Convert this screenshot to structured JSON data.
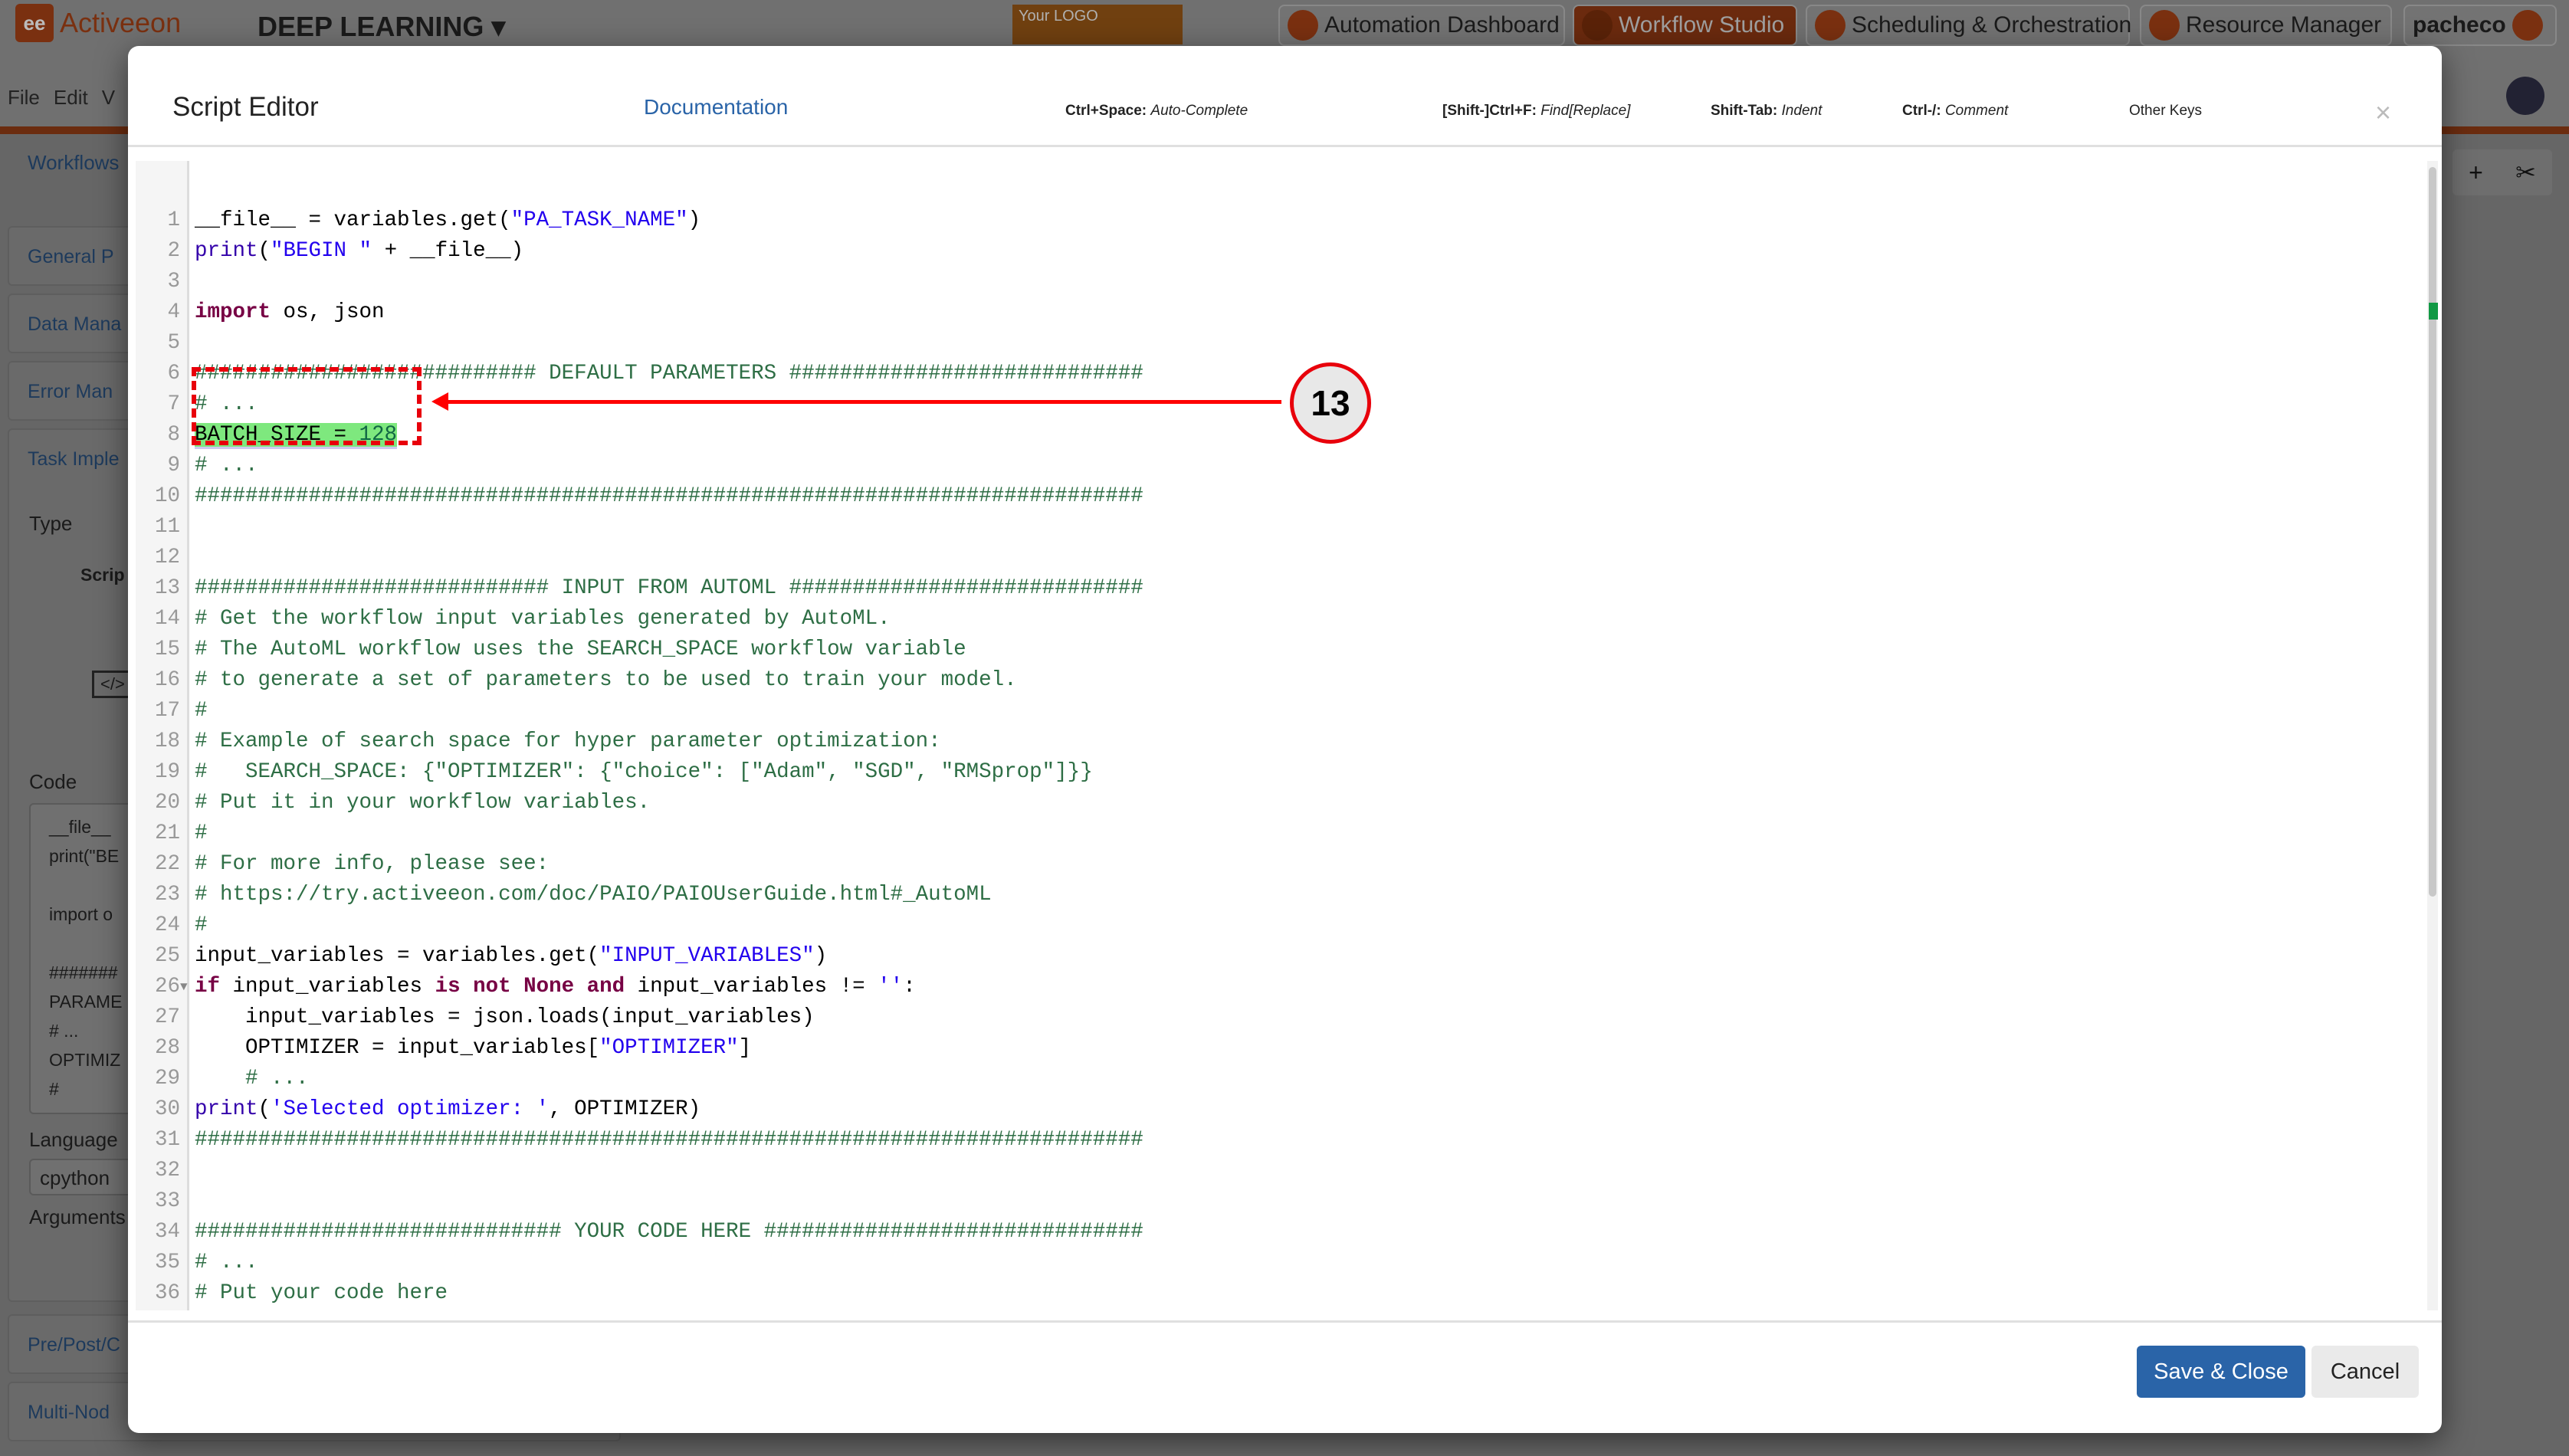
{
  "app": {
    "logo_text": "Activeeon",
    "product": "DEEP LEARNING ▾",
    "your_logo": "Your LOGO",
    "tabs": [
      {
        "label": "Automation Dashboard",
        "active": false
      },
      {
        "label": "Workflow Studio",
        "active": true
      },
      {
        "label": "Scheduling & Orchestration",
        "active": false
      },
      {
        "label": "Resource Manager",
        "active": false
      }
    ],
    "user": "pacheco",
    "menu": [
      "File",
      "Edit",
      "V"
    ],
    "side": {
      "workflows": "Workflows",
      "sections": [
        "General P",
        "Data Mana",
        "Error Man",
        "Task Imple"
      ],
      "type_label": "Type",
      "type_value": "Scrip",
      "code_label": "Code",
      "code_preview": "__file__\nprint(\"BE\n\nimport o\n\n#######\nPARAME\n# ...\nOPTIMIZ\n#",
      "language_label": "Language",
      "language_value": "cpython",
      "arguments_label": "Arguments",
      "bottom_sections": [
        "Pre/Post/C",
        "Multi-Nod"
      ]
    },
    "tools": [
      "+",
      "✂"
    ]
  },
  "modal": {
    "title": "Script Editor",
    "documentation": "Documentation",
    "shortcuts": [
      {
        "key": "Ctrl+Space:",
        "action": "Auto-Complete"
      },
      {
        "key": "[Shift-]Ctrl+F:",
        "action": "Find[Replace]"
      },
      {
        "key": "Shift-Tab:",
        "action": "Indent"
      },
      {
        "key": "Ctrl-/:",
        "action": "Comment"
      },
      {
        "key": "",
        "action": "Other Keys"
      }
    ],
    "close": "×",
    "save_label": "Save & Close",
    "cancel_label": "Cancel"
  },
  "annotation": {
    "number": "13",
    "color": "#e8000b"
  },
  "code_lines": [
    [
      [
        "",
        "__file__ = variables.get("
      ],
      [
        "str",
        "\"PA_TASK_NAME\""
      ],
      [
        "",
        ")"
      ]
    ],
    [
      [
        "builtin",
        "print"
      ],
      [
        "",
        "("
      ],
      [
        "str",
        "\"BEGIN \""
      ],
      [
        "",
        " + __file__)"
      ]
    ],
    [],
    [
      [
        "kw",
        "import"
      ],
      [
        "",
        " os, json"
      ]
    ],
    [],
    [
      [
        "comment",
        "########################### DEFAULT PARAMETERS ############################"
      ]
    ],
    [
      [
        "comment",
        "# ..."
      ]
    ],
    [
      [
        "hl",
        "BATCH_SIZE = "
      ],
      [
        "hlnum",
        "128"
      ]
    ],
    [
      [
        "comment",
        "# ..."
      ]
    ],
    [
      [
        "comment",
        "###########################################################################"
      ]
    ],
    [],
    [],
    [
      [
        "comment",
        "############################ INPUT FROM AUTOML ############################"
      ]
    ],
    [
      [
        "comment",
        "# Get the workflow input variables generated by AutoML."
      ]
    ],
    [
      [
        "comment",
        "# The AutoML workflow uses the SEARCH_SPACE workflow variable"
      ]
    ],
    [
      [
        "comment",
        "# to generate a set of parameters to be used to train your model."
      ]
    ],
    [
      [
        "comment",
        "#"
      ]
    ],
    [
      [
        "comment",
        "# Example of search space for hyper parameter optimization:"
      ]
    ],
    [
      [
        "comment",
        "#   SEARCH_SPACE: {\"OPTIMIZER\": {\"choice\": [\"Adam\", \"SGD\", \"RMSprop\"]}}"
      ]
    ],
    [
      [
        "comment",
        "# Put it in your workflow variables."
      ]
    ],
    [
      [
        "comment",
        "#"
      ]
    ],
    [
      [
        "comment",
        "# For more info, please see:"
      ]
    ],
    [
      [
        "comment",
        "# https://try.activeeon.com/doc/PAIO/PAIOUserGuide.html#_AutoML"
      ]
    ],
    [
      [
        "comment",
        "#"
      ]
    ],
    [
      [
        "",
        "input_variables = variables.get("
      ],
      [
        "str",
        "\"INPUT_VARIABLES\""
      ],
      [
        "",
        ")"
      ]
    ],
    [
      [
        "kw",
        "if"
      ],
      [
        "",
        " input_variables "
      ],
      [
        "kw",
        "is not None and"
      ],
      [
        "",
        " input_variables != "
      ],
      [
        "str",
        "''"
      ],
      [
        "",
        ":"
      ]
    ],
    [
      [
        "",
        "    input_variables = json.loads(input_variables)"
      ]
    ],
    [
      [
        "",
        "    OPTIMIZER = input_variables["
      ],
      [
        "str",
        "\"OPTIMIZER\""
      ],
      [
        "",
        "]"
      ]
    ],
    [
      [
        "",
        "    "
      ],
      [
        "comment",
        "# ..."
      ]
    ],
    [
      [
        "builtin",
        "print"
      ],
      [
        "",
        "("
      ],
      [
        "str",
        "'Selected optimizer: '"
      ],
      [
        "",
        ", OPTIMIZER)"
      ]
    ],
    [
      [
        "comment",
        "###########################################################################"
      ]
    ],
    [],
    [],
    [
      [
        "comment",
        "############################# YOUR CODE HERE ##############################"
      ]
    ],
    [
      [
        "comment",
        "# ..."
      ]
    ],
    [
      [
        "comment",
        "# Put your code here"
      ]
    ],
    [
      [
        "comment",
        "# ..."
      ]
    ]
  ],
  "fold_line": 26
}
